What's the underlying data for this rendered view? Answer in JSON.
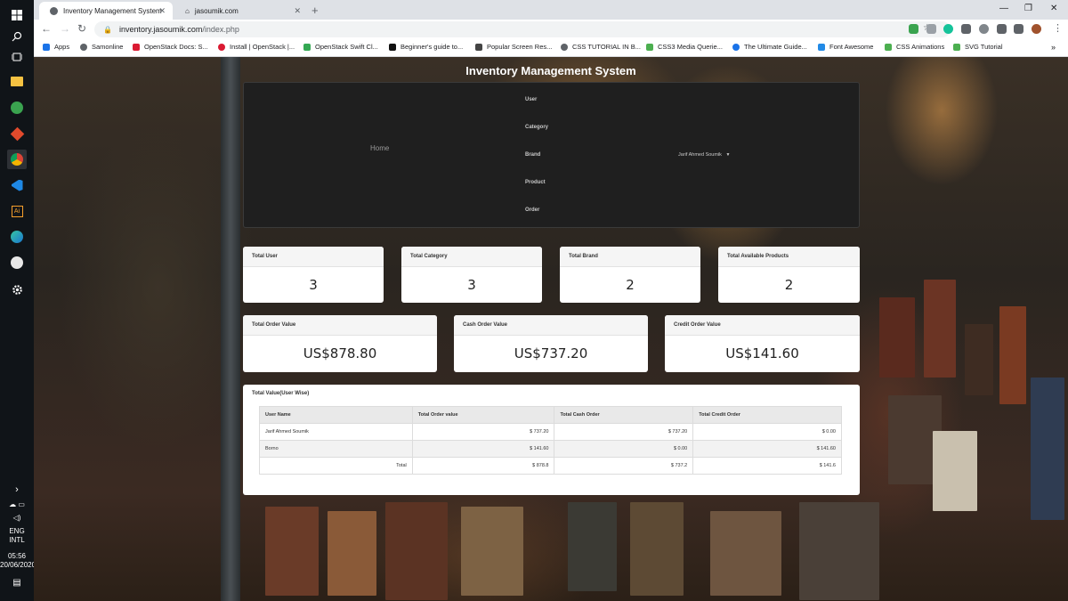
{
  "browser": {
    "tabs": [
      {
        "title": "Inventory Management System",
        "active": true
      },
      {
        "title": "jasoumik.com",
        "active": false
      }
    ],
    "url_host": "inventory.jasoumik.com",
    "url_path": "/index.php",
    "bookmarks": [
      "Apps",
      "Samonline",
      "OpenStack Docs: S...",
      "Install | OpenStack |...",
      "OpenStack Swift Cl...",
      "Beginner's guide to...",
      "Popular Screen Res...",
      "CSS TUTORIAL IN B...",
      "CSS3 Media Querie...",
      "The Ultimate Guide...",
      "Font Awesome",
      "CSS Animations",
      "SVG Tutorial"
    ],
    "bookmarks_more": "»"
  },
  "taskbar": {
    "language": "ENG",
    "layout": "INTL",
    "time": "05:56",
    "date": "20/06/2020"
  },
  "site": {
    "title": "Inventory Management System",
    "nav": {
      "home": "Home",
      "items": [
        "User",
        "Category",
        "Brand",
        "Product",
        "Order"
      ],
      "user_dropdown": "Jarif Ahmed Soumik"
    },
    "stats_row1": [
      {
        "label": "Total User",
        "value": "3"
      },
      {
        "label": "Total Category",
        "value": "3"
      },
      {
        "label": "Total Brand",
        "value": "2"
      },
      {
        "label": "Total Available Products",
        "value": "2"
      }
    ],
    "stats_row2": [
      {
        "label": "Total Order Value",
        "value": "US$878.80"
      },
      {
        "label": "Cash Order Value",
        "value": "US$737.20"
      },
      {
        "label": "Credit Order Value",
        "value": "US$141.60"
      }
    ],
    "table": {
      "title": "Total Value(User Wise)",
      "headers": [
        "User Name",
        "Total Order value",
        "Total Cash Order",
        "Total Credit Order"
      ],
      "rows": [
        [
          "Jarif Ahmed Soumik",
          "$ 737.20",
          "$ 737.20",
          "$ 0.00"
        ],
        [
          "Borno",
          "$ 141.60",
          "$ 0.00",
          "$ 141.60"
        ],
        [
          "Total",
          "$ 878.8",
          "$ 737.2",
          "$ 141.6"
        ]
      ]
    }
  }
}
